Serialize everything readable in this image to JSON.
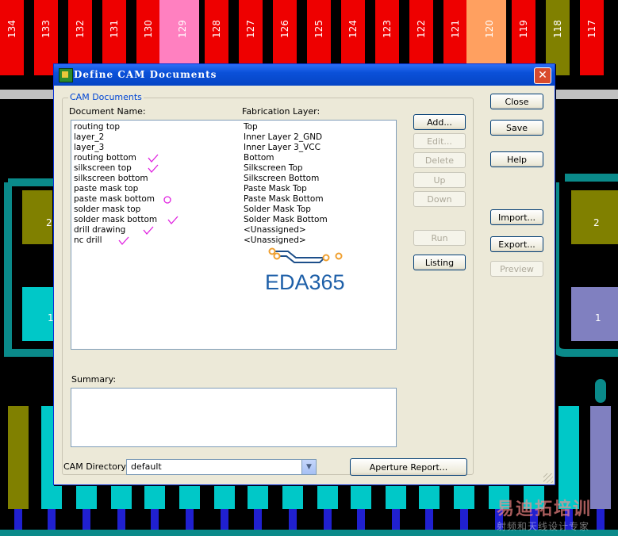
{
  "background": {
    "pad_labels": [
      "134",
      "133",
      "132",
      "131",
      "130",
      "129",
      "128",
      "127",
      "126",
      "125",
      "124",
      "123",
      "122",
      "121",
      "120",
      "119",
      "118",
      "117"
    ],
    "side_labels": [
      "2",
      "1",
      "2",
      "1"
    ],
    "colors": {
      "pad_red": "#ee0000",
      "pad_pink": "#ff80c0",
      "pad_orange": "#ffa060",
      "pad_olive": "#808000",
      "pad_cyan": "#00c8c8",
      "pad_purple": "#8080c0",
      "trace_gray": "#c0c0c0",
      "teal_ring": "#0a8a8a",
      "blue": "#2020d0"
    }
  },
  "dialog": {
    "title": "Define CAM Documents",
    "close_icon": "close-icon",
    "group_label": "CAM Documents",
    "col_document": "Document Name:",
    "col_fab_layer": "Fabrication Layer:",
    "rows": [
      {
        "doc": "routing top",
        "layer": "Top",
        "mark": ""
      },
      {
        "doc": "layer_2",
        "layer": "Inner Layer 2_GND",
        "mark": ""
      },
      {
        "doc": "layer_3",
        "layer": "Inner Layer 3_VCC",
        "mark": ""
      },
      {
        "doc": "routing bottom",
        "layer": "Bottom",
        "mark": "check"
      },
      {
        "doc": "silkscreen top",
        "layer": "Silkscreen Top",
        "mark": "check"
      },
      {
        "doc": "silkscreen bottom",
        "layer": "Silkscreen Bottom",
        "mark": ""
      },
      {
        "doc": "paste mask top",
        "layer": "Paste Mask Top",
        "mark": ""
      },
      {
        "doc": "paste mask bottom",
        "layer": "Paste Mask Bottom",
        "mark": "circle"
      },
      {
        "doc": "solder mask top",
        "layer": "Solder Mask Top",
        "mark": ""
      },
      {
        "doc": "solder mask bottom",
        "layer": "Solder Mask Bottom",
        "mark": "check"
      },
      {
        "doc": "drill drawing",
        "layer": "<Unassigned>",
        "mark": "check"
      },
      {
        "doc": "nc drill",
        "layer": "<Unassigned>",
        "mark": "check"
      }
    ],
    "logo_text": "EDA365",
    "summary_label": "Summary:",
    "cam_dir_label": "CAM Directory:",
    "cam_dir_value": "default",
    "aperture_button": "Aperture Report...",
    "buttons": {
      "add": "Add...",
      "edit": "Edit...",
      "delete": "Delete",
      "up": "Up",
      "down": "Down",
      "run": "Run",
      "listing": "Listing",
      "close": "Close",
      "save": "Save",
      "help": "Help",
      "import": "Import...",
      "export": "Export...",
      "preview": "Preview"
    },
    "annotation_color": "#e020e0"
  },
  "watermark": {
    "main": "易迪拓培训",
    "sub": "射频和天线设计专家"
  }
}
